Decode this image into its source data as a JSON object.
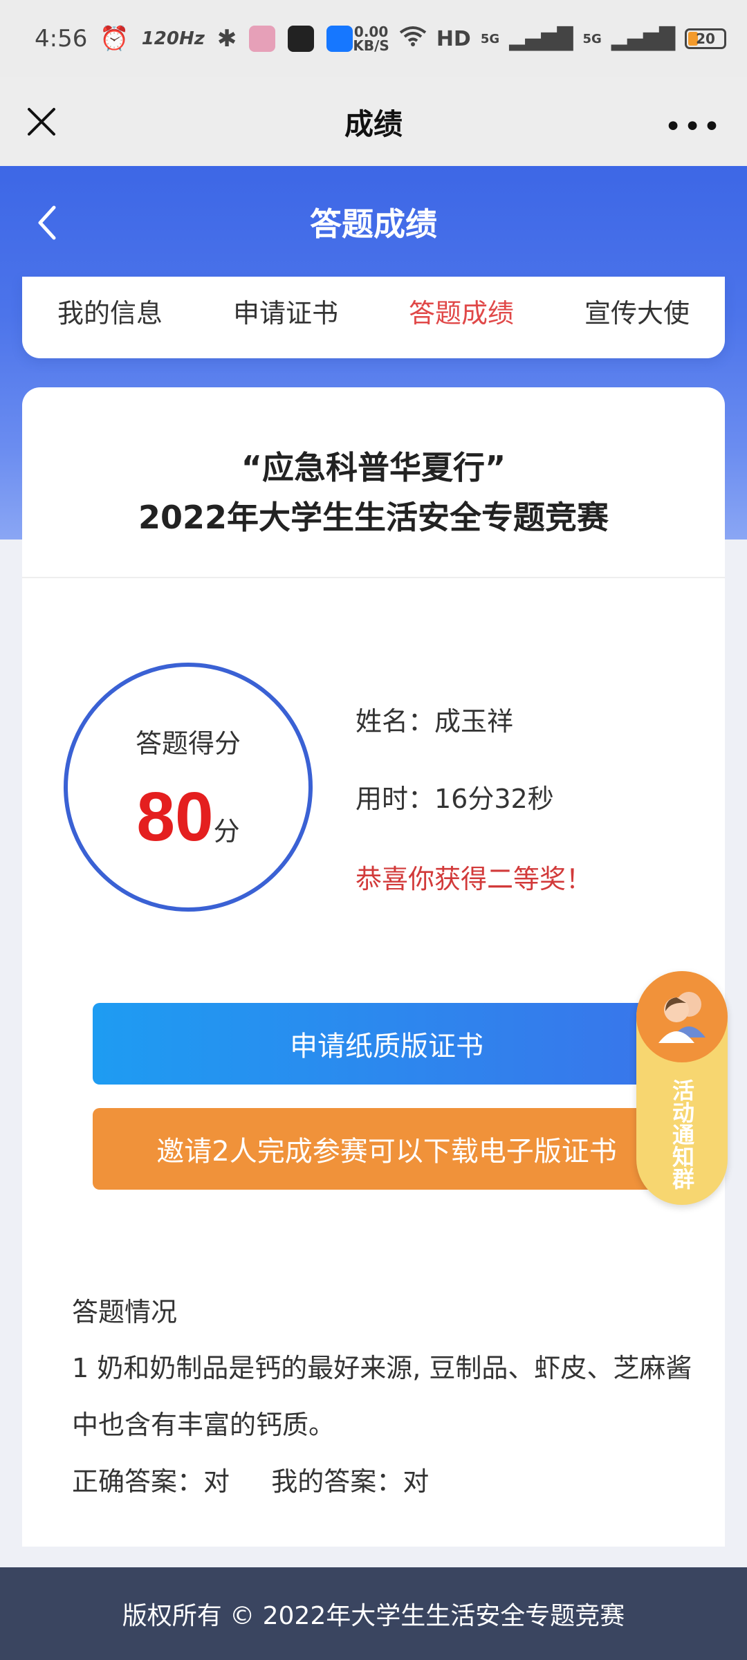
{
  "status_bar": {
    "time": "4:56",
    "refresh_rate": "120Hz",
    "net_speed_value": "0.00",
    "net_speed_unit": "KB/S",
    "network": "HD",
    "signal1": "5G",
    "signal2": "5G",
    "battery": "20"
  },
  "title_bar": {
    "title": "成绩",
    "more": "•••"
  },
  "header": {
    "title": "答题成绩"
  },
  "tabs": [
    {
      "label": "我的信息",
      "active": false
    },
    {
      "label": "申请证书",
      "active": false
    },
    {
      "label": "答题成绩",
      "active": true
    },
    {
      "label": "宣传大使",
      "active": false
    }
  ],
  "contest": {
    "title_line1": "“应急科普华夏行”",
    "title_line2": "2022年大学生生活安全专题竞赛"
  },
  "score": {
    "label": "答题得分",
    "value": "80",
    "unit": "分"
  },
  "info": {
    "name": "姓名：成玉祥",
    "time_used": "用时：16分32秒",
    "congrats": "恭喜你获得二等奖！"
  },
  "buttons": {
    "paper_cert": "申请纸质版证书",
    "invite": "邀请2人完成参赛可以下载电子版证书"
  },
  "float_badge": {
    "label": "活动通知群"
  },
  "answers": {
    "heading": "答题情况",
    "question": "1 奶和奶制品是钙的最好来源, 豆制品、虾皮、芝麻酱中也含有丰富的钙质。",
    "correct_answer": "正确答案：对",
    "my_answer": "我的答案：对"
  },
  "footer": {
    "text": "版权所有 © 2022年大学生生活安全专题竞赛"
  },
  "colors": {
    "primary_blue": "#3d67e6",
    "accent_red": "#e41f1f",
    "orange": "#f0923a",
    "footer_bg": "#3a4560"
  }
}
